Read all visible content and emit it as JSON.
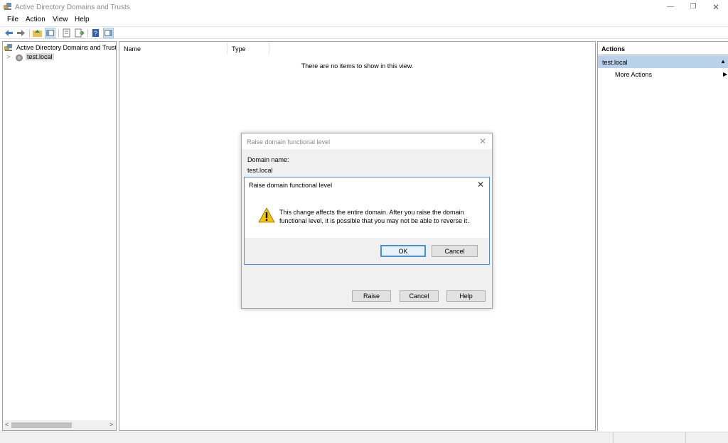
{
  "window": {
    "title": "Active Directory Domains and Trusts",
    "controls": {
      "minimize": "—",
      "maximize": "❐",
      "close": "✕"
    }
  },
  "menu": [
    "File",
    "Action",
    "View",
    "Help"
  ],
  "toolbar": {
    "icons": [
      "back-arrow-icon",
      "forward-arrow-icon",
      "up-folder-icon",
      "show-hide-tree-icon",
      "properties-icon",
      "export-list-icon",
      "help-icon",
      "show-hide-action-pane-icon"
    ]
  },
  "tree": {
    "root": "Active Directory Domains and Trust",
    "expander": ">",
    "child": "test.local"
  },
  "scroll": {
    "left": "<",
    "right": ">"
  },
  "list": {
    "columns": [
      "Name",
      "Type"
    ],
    "empty_message": "There are no items to show in this view."
  },
  "actions": {
    "title": "Actions",
    "section": "test.local",
    "collapse": "▲",
    "more": "More Actions",
    "more_arrow": "▶"
  },
  "dialog": {
    "title": "Raise domain functional level",
    "close": "✕",
    "domain_label": "Domain name:",
    "domain_value": "test.local",
    "raise_button": "Raise",
    "cancel_button": "Cancel",
    "help_button": "Help"
  },
  "message_box": {
    "title": "Raise domain functional level",
    "close": "✕",
    "message": "This change affects the entire domain. After you raise the domain functional level, it is possible that you may not be able to reverse it.",
    "ok_button": "OK",
    "cancel_button": "Cancel"
  },
  "colors": {
    "selection": "#b9d1ea",
    "focus_border": "#4a90d9",
    "warning": "#f5c400"
  }
}
